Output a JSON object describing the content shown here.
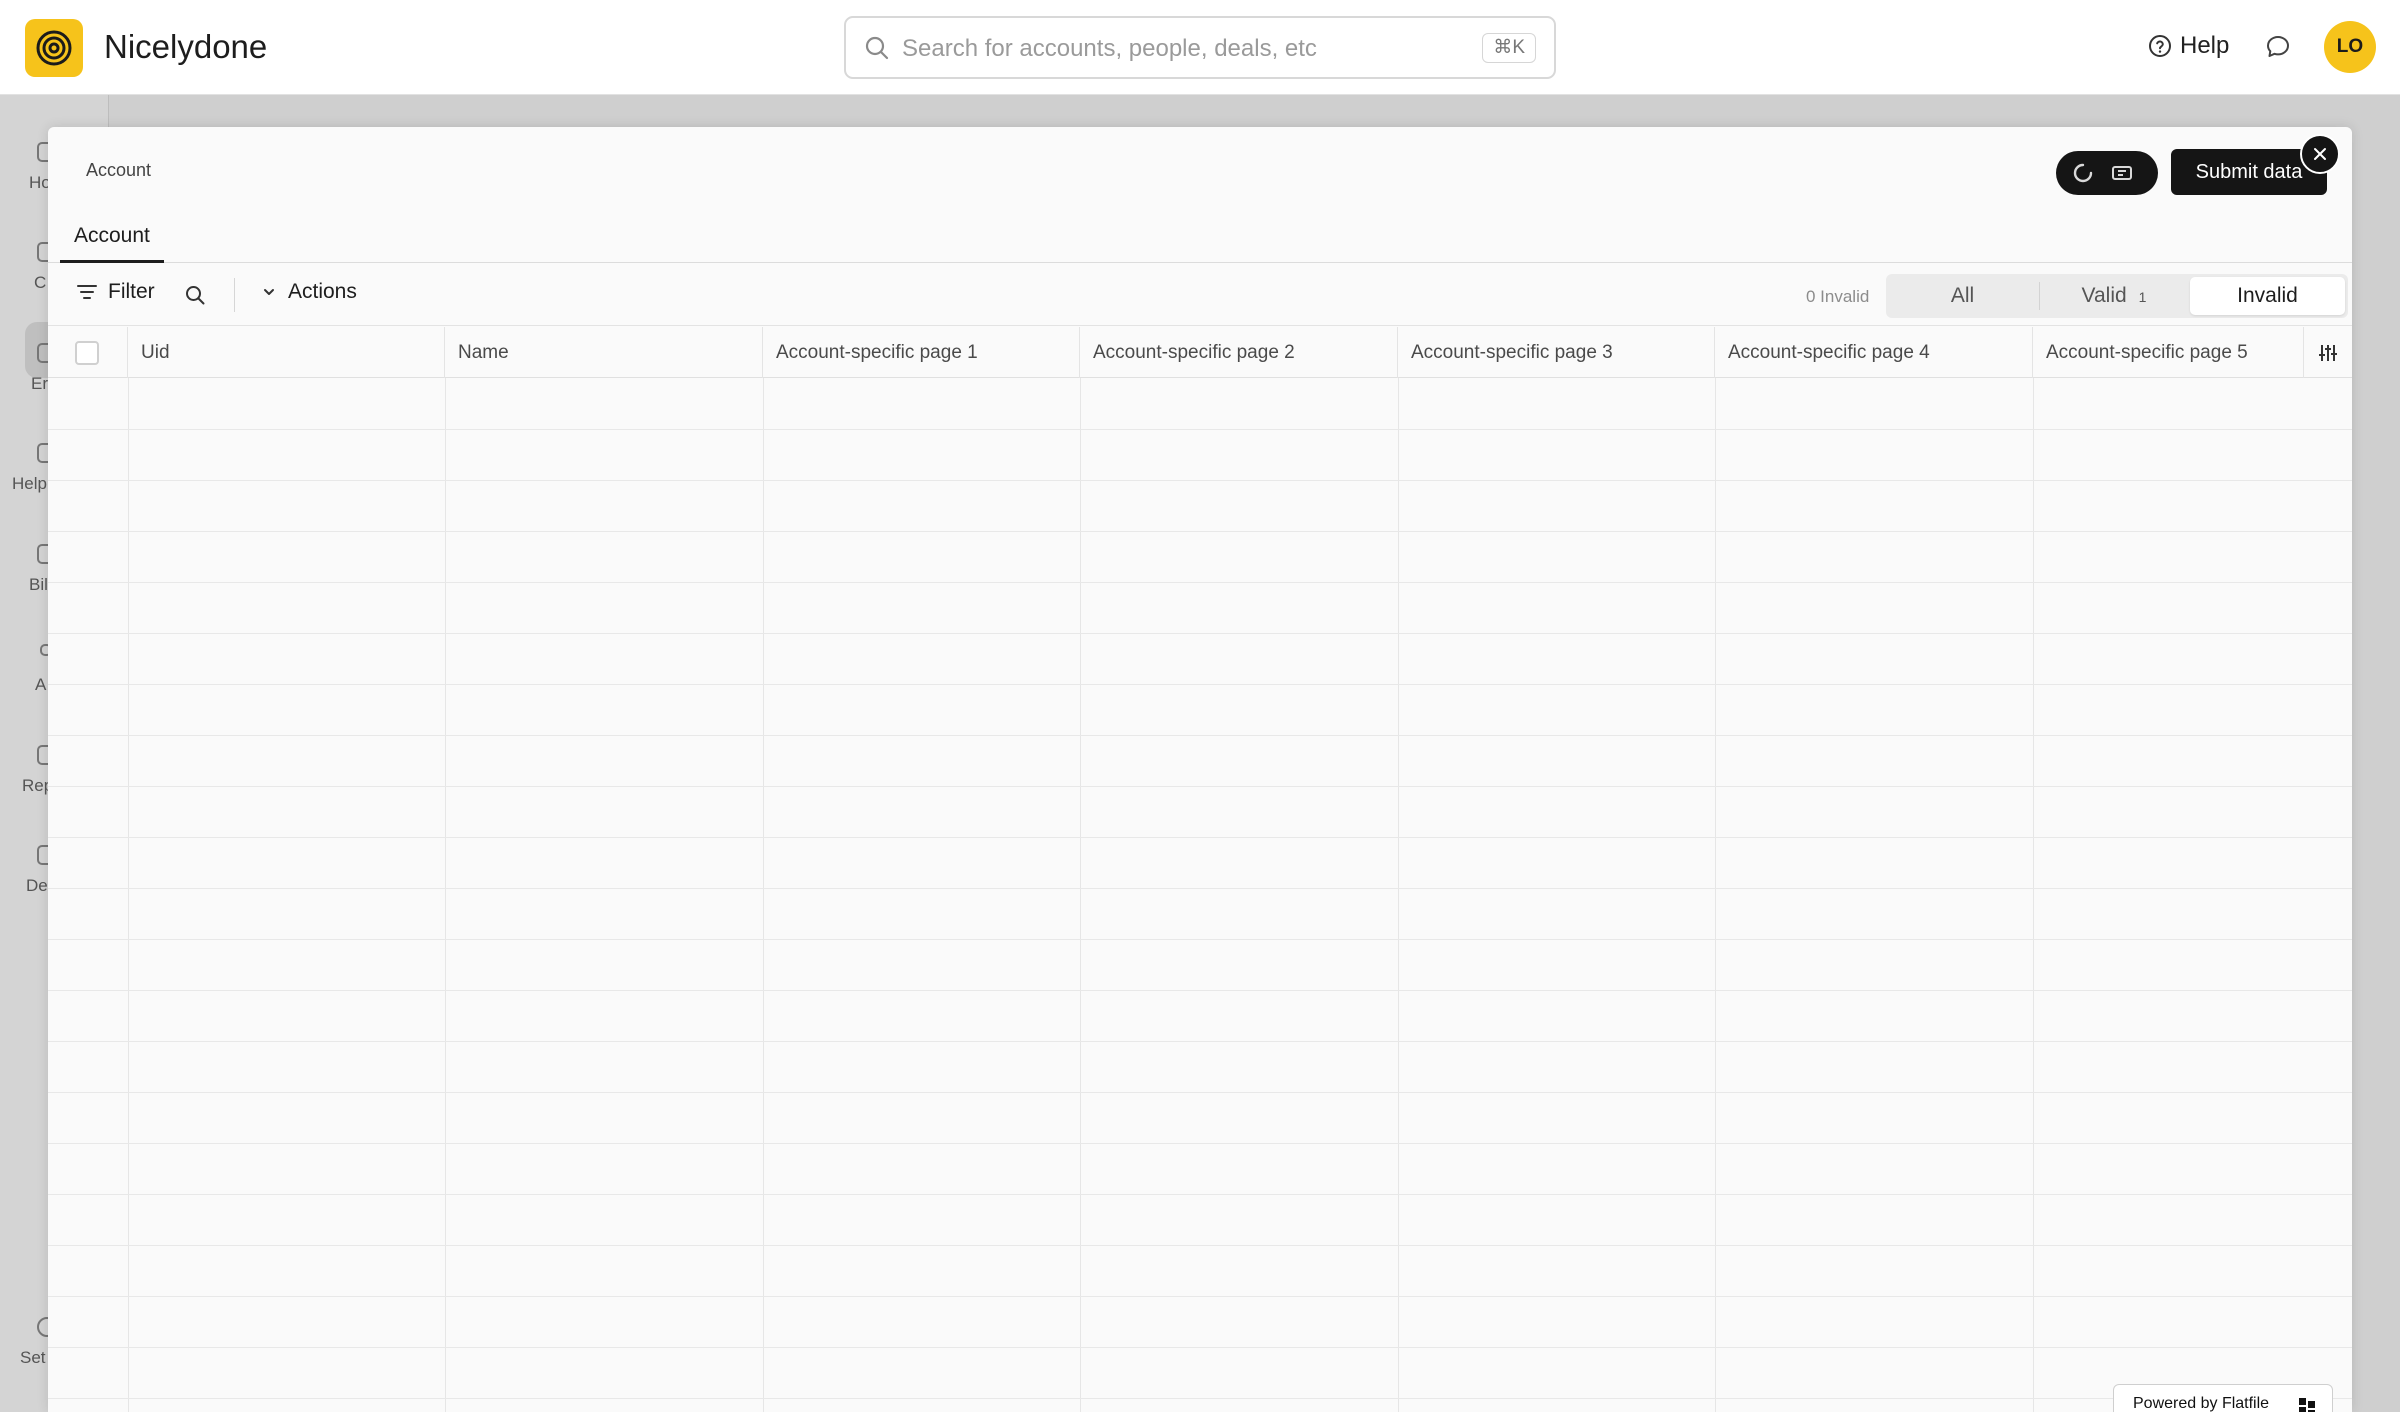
{
  "app": {
    "name": "Nicelydone",
    "brand_color": "#f6c31b"
  },
  "header": {
    "search_placeholder": "Search for accounts, people, deals, etc",
    "search_shortcut": "⌘K",
    "help_label": "Help",
    "avatar_initials": "LO"
  },
  "sidebar": {
    "items": [
      {
        "label": "Ho",
        "icon": "home-icon"
      },
      {
        "label": "C",
        "icon": "contacts-icon"
      },
      {
        "label": "Er",
        "icon": "enrichment-icon"
      },
      {
        "label": "Help",
        "icon": "help-icon"
      },
      {
        "label": "Bil",
        "icon": "billing-icon"
      },
      {
        "label": "A",
        "icon": "apps-icon"
      },
      {
        "label": "Rep",
        "icon": "reports-icon"
      },
      {
        "label": "De",
        "icon": "deals-icon"
      },
      {
        "label": "Set",
        "icon": "settings-icon"
      }
    ]
  },
  "modal": {
    "breadcrumb": "Account",
    "submit_label": "Submit data",
    "tab": "Account",
    "toolbar": {
      "filter_label": "Filter",
      "actions_label": "Actions",
      "invalid_count": "0 Invalid",
      "segments": {
        "all": "All",
        "valid": "Valid",
        "valid_count": "1",
        "invalid": "Invalid"
      },
      "active_segment": "Invalid"
    },
    "columns": [
      "Uid",
      "Name",
      "Account-specific page 1",
      "Account-specific page 2",
      "Account-specific page 3",
      "Account-specific page 4",
      "Account-specific page 5"
    ],
    "rows": [],
    "powered_by": "Powered by Flatfile"
  }
}
